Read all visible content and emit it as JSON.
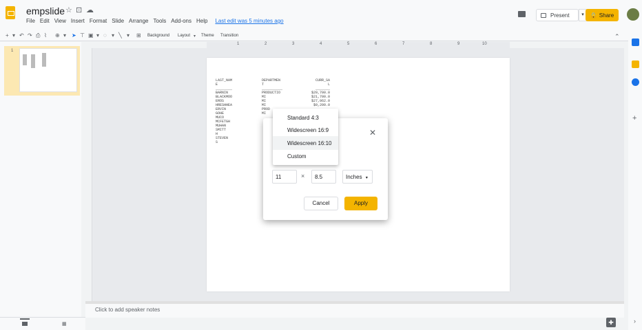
{
  "header": {
    "doc_title": "empslide",
    "menu": [
      "File",
      "Edit",
      "View",
      "Insert",
      "Format",
      "Slide",
      "Arrange",
      "Tools",
      "Add-ons",
      "Help"
    ],
    "last_edit": "Last edit was 5 minutes ago",
    "present_label": "Present",
    "share_label": "Share"
  },
  "toolbar": {
    "background_label": "Background",
    "layout_label": "Layout",
    "theme_label": "Theme",
    "transition_label": "Transition"
  },
  "ruler": [
    "1",
    "2",
    "3",
    "4",
    "5",
    "6",
    "7",
    "8",
    "9",
    "10"
  ],
  "filmstrip": {
    "slide_number": "1"
  },
  "slide": {
    "col1": "LAST_NAM\nE\n________\nBARNIN\nBLACKMOO\nEROS\nHRESHHEA\nERVIN\nGOHE\nMUCO\nMCFETGH\nMUHAN\nSMITT\nH\nSTEVEN\nS",
    "col2": "DEPARTMEN\nT\n__________\nPRODUCTIO\nMI\nMI\nMI\nPROD\nMI\n\n\n\n\n\n\n",
    "col3": "CURR_SA\nL\n_______\n$29,700.0\n$21,700.0\n$27,062.0\n$9,200.0"
  },
  "notes": {
    "placeholder": "Click to add speaker notes"
  },
  "dialog": {
    "width_value": "11",
    "height_value": "8.5",
    "times": "×",
    "unit": "Inches",
    "cancel_label": "Cancel",
    "apply_label": "Apply"
  },
  "dropdown": {
    "options": [
      "Standard 4:3",
      "Widescreen 16:9",
      "Widescreen 16:10",
      "Custom"
    ],
    "selected": "Widescreen 16:10"
  },
  "colors": {
    "accent": "#f4b400",
    "link": "#1a73e8"
  }
}
